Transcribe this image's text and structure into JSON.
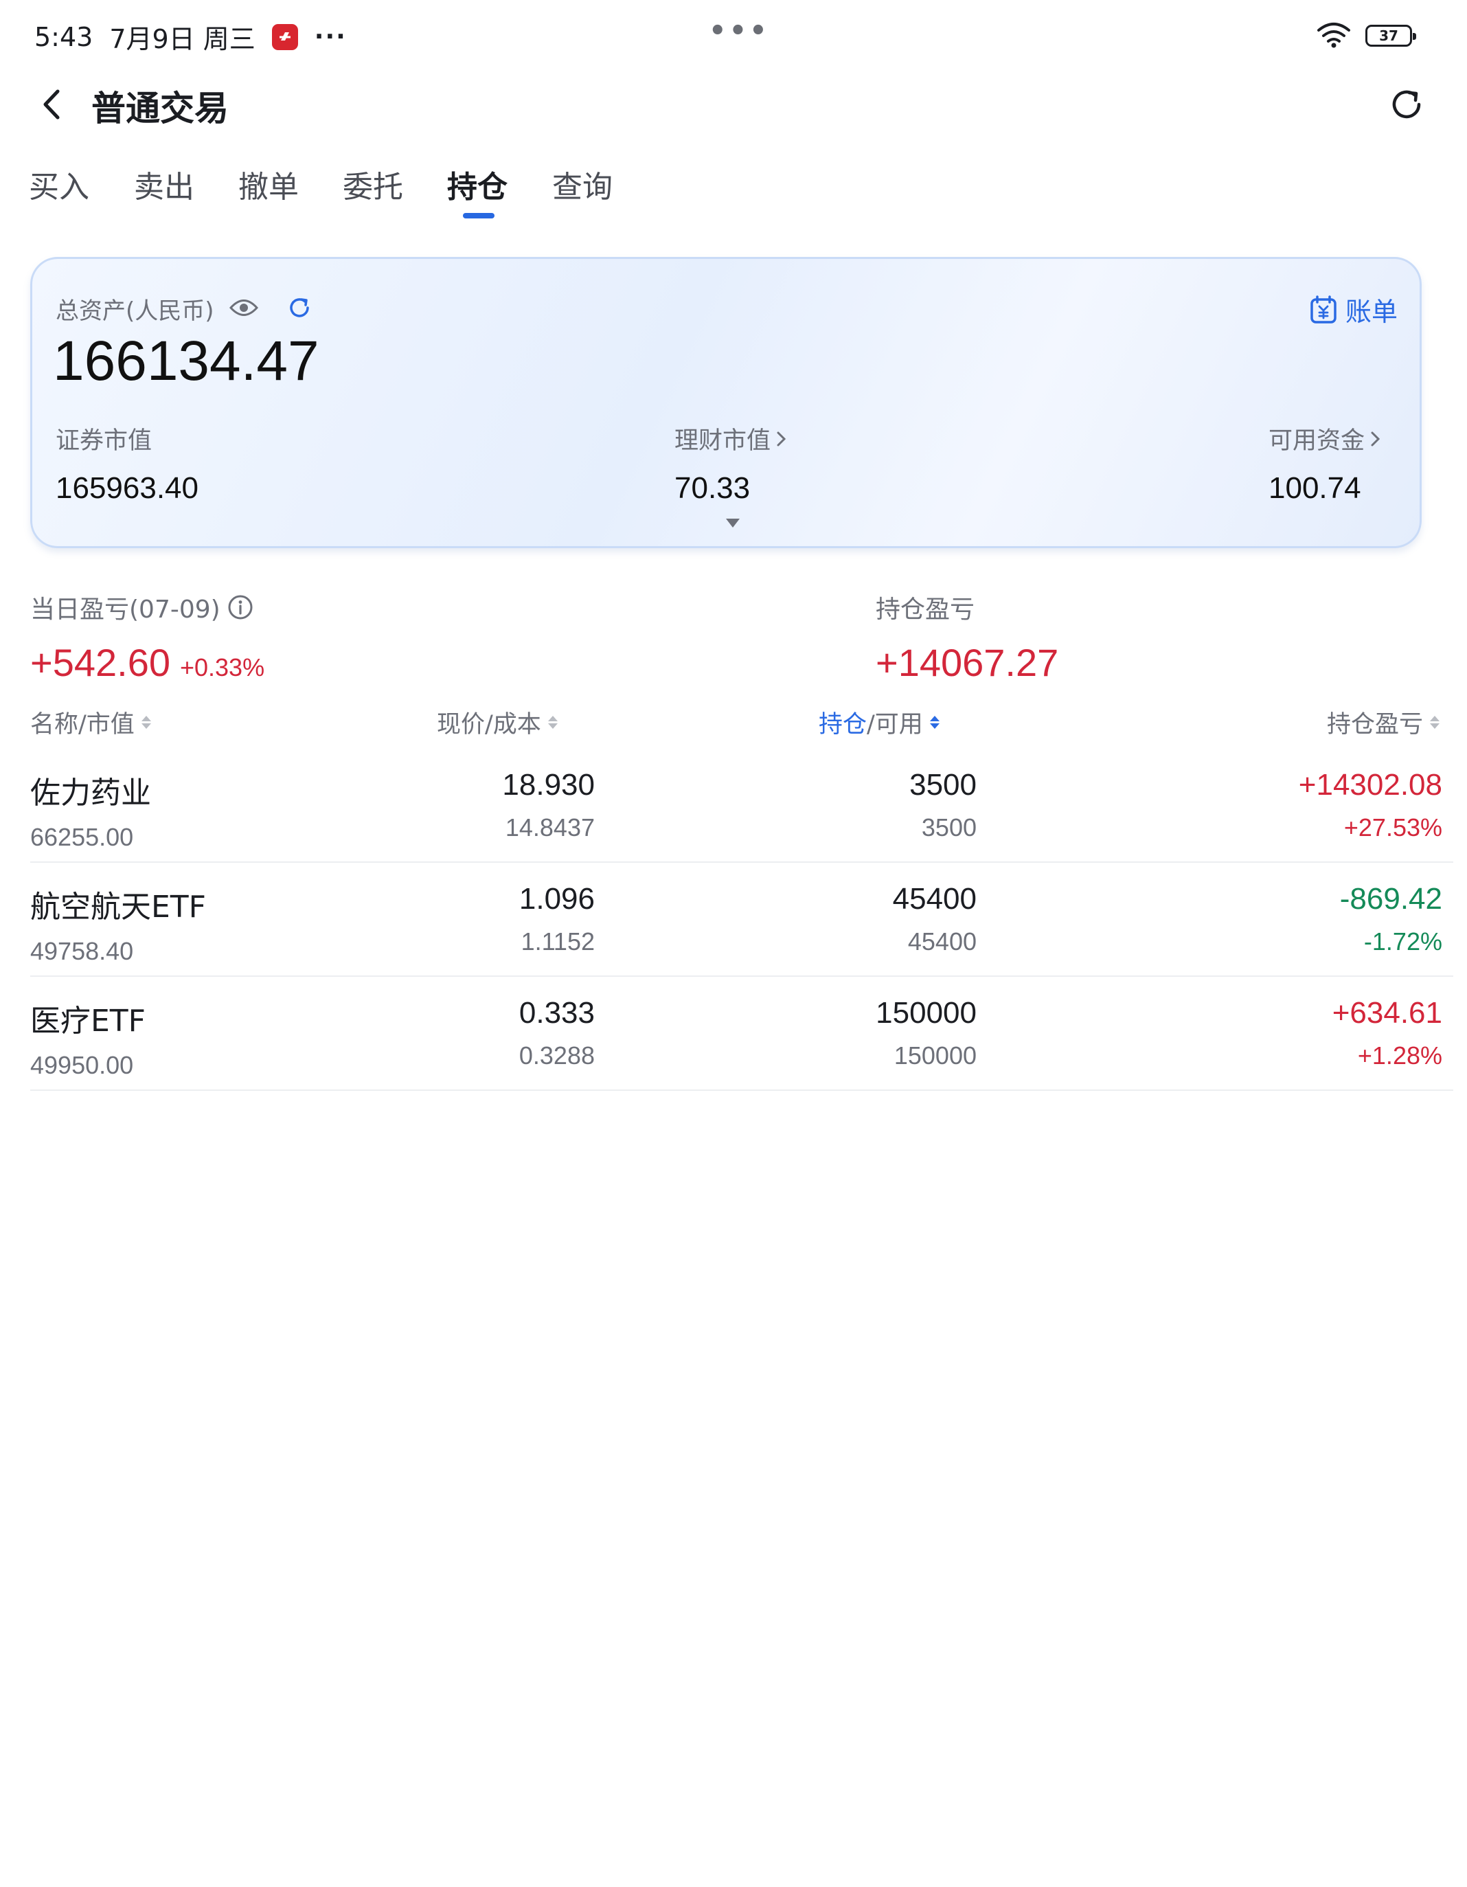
{
  "status_bar": {
    "time": "5:43",
    "date": "7月9日 周三",
    "more": "···",
    "battery": "37",
    "icons": [
      "app-badge-icon",
      "wifi-icon",
      "battery-icon"
    ]
  },
  "header": {
    "title": "普通交易",
    "icons": [
      "back-arrow-icon",
      "refresh-icon"
    ]
  },
  "tabs": [
    {
      "label": "买入"
    },
    {
      "label": "卖出"
    },
    {
      "label": "撤单"
    },
    {
      "label": "委托"
    },
    {
      "label": "持仓",
      "active": true
    },
    {
      "label": "查询"
    }
  ],
  "asset_card": {
    "total_label": "总资产(人民币)",
    "total_value": "166134.47",
    "bill_label": "账单",
    "securities": {
      "label": "证券市值",
      "value": "165963.40"
    },
    "wealth": {
      "label": "理财市值",
      "value": "70.33"
    },
    "available": {
      "label": "可用资金",
      "value": "100.74"
    }
  },
  "profit": {
    "daily_label": "当日盈亏(07-09)",
    "daily_value": "+542.60",
    "daily_pct": "+0.33%",
    "position_label": "持仓盈亏",
    "position_value": "+14067.27"
  },
  "table": {
    "headers": {
      "name": "名称/市值",
      "price": "现价/成本",
      "qty_highlight": "持仓",
      "qty_rest": "/可用",
      "pl": "持仓盈亏"
    },
    "rows": [
      {
        "name": "佐力药业",
        "market_value": "66255.00",
        "price": "18.930",
        "cost": "14.8437",
        "qty": "3500",
        "available": "3500",
        "pl": "+14302.08",
        "pl_pct": "+27.53%",
        "trend": "up"
      },
      {
        "name": "航空航天ETF",
        "market_value": "49758.40",
        "price": "1.096",
        "cost": "1.1152",
        "qty": "45400",
        "available": "45400",
        "pl": "-869.42",
        "pl_pct": "-1.72%",
        "trend": "down"
      },
      {
        "name": "医疗ETF",
        "market_value": "49950.00",
        "price": "0.333",
        "cost": "0.3288",
        "qty": "150000",
        "available": "150000",
        "pl": "+634.61",
        "pl_pct": "+1.28%",
        "trend": "up"
      }
    ]
  },
  "colors": {
    "accent": "#2a6ae3",
    "gain": "#d3263a",
    "loss": "#148a58"
  }
}
